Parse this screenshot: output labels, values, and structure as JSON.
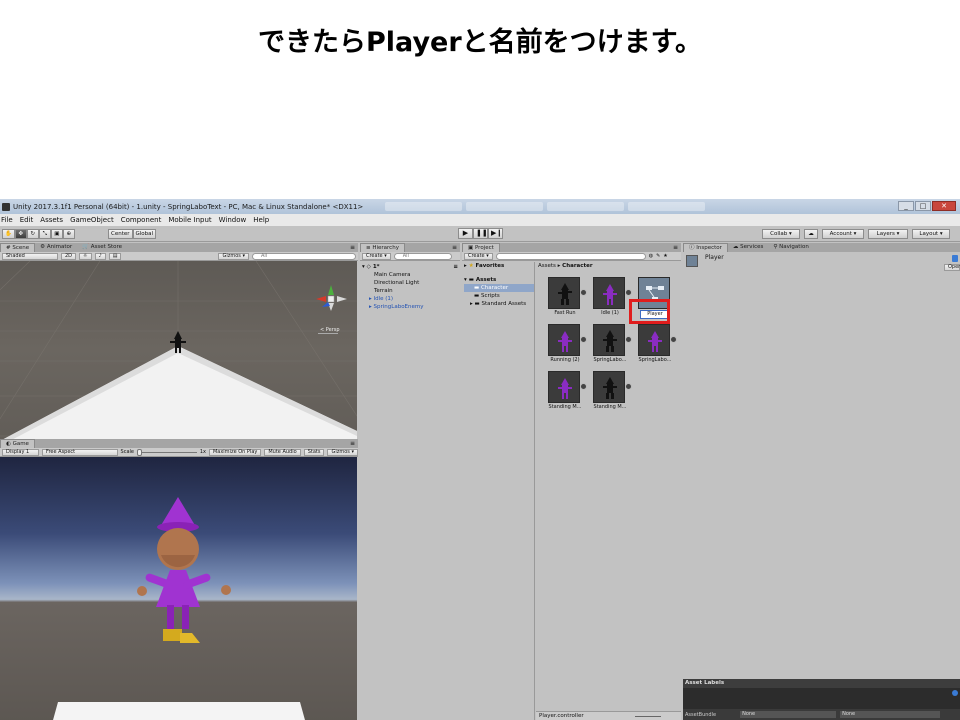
{
  "slide": {
    "title": "できたらPlayerと名前をつけます。"
  },
  "window": {
    "title": "Unity 2017.3.1f1 Personal (64bit) - 1.unity - SpringLaboText - PC, Mac & Linux Standalone* <DX11>",
    "minimize": "_",
    "maximize": "□",
    "close": "✕"
  },
  "menu": [
    "File",
    "Edit",
    "Assets",
    "GameObject",
    "Component",
    "Mobile Input",
    "Window",
    "Help"
  ],
  "toolbar": {
    "center": "Center",
    "global": "Global",
    "collab": "Collab ▾",
    "account": "Account ▾",
    "layers": "Layers ▾",
    "layout": "Layout ▾"
  },
  "scene_panel": {
    "tabs": [
      "Scene",
      "Animator",
      "Asset Store"
    ],
    "shading": "Shaded",
    "mode2d": "2D",
    "gizmos": "Gizmos ▾",
    "search": "All",
    "persp": "< Persp"
  },
  "game_panel": {
    "tab": "Game",
    "display": "Display 1",
    "aspect": "Free Aspect",
    "scale_label": "Scale",
    "scale_value": "1x",
    "maximize": "Maximize On Play",
    "mute": "Mute Audio",
    "stats": "Stats",
    "gizmos": "Gizmos ▾"
  },
  "hierarchy": {
    "tab": "Hierarchy",
    "create": "Create ▾",
    "search": "All",
    "scene": "1*",
    "items": [
      {
        "label": "Main Camera"
      },
      {
        "label": "Directional Light"
      },
      {
        "label": "Terrain"
      },
      {
        "label": "Idle (1)"
      },
      {
        "label": "SpringLaboEnemy"
      }
    ]
  },
  "project": {
    "tab": "Project",
    "create": "Create ▾",
    "favorites": "Favorites",
    "assets": "Assets",
    "tree": [
      "Character",
      "Scripts",
      "Standard Assets"
    ],
    "breadcrumb": [
      "Assets",
      "Character"
    ],
    "items": [
      {
        "label": "Fast Run"
      },
      {
        "label": "Idle (1)"
      },
      {
        "label": "Player"
      },
      {
        "label": "Running (2)"
      },
      {
        "label": "SpringLabo..."
      },
      {
        "label": "SpringLabo..."
      },
      {
        "label": "Standing M..."
      },
      {
        "label": "Standing M..."
      }
    ],
    "footer": "Player.controller"
  },
  "inspector": {
    "tabs": [
      "Inspector",
      "Services",
      "Navigation"
    ],
    "object_name": "Player",
    "open_button": "Open",
    "asset_labels": "Asset Labels",
    "asset_bundle": "AssetBundle",
    "bundle_value1": "None",
    "bundle_value2": "None"
  }
}
